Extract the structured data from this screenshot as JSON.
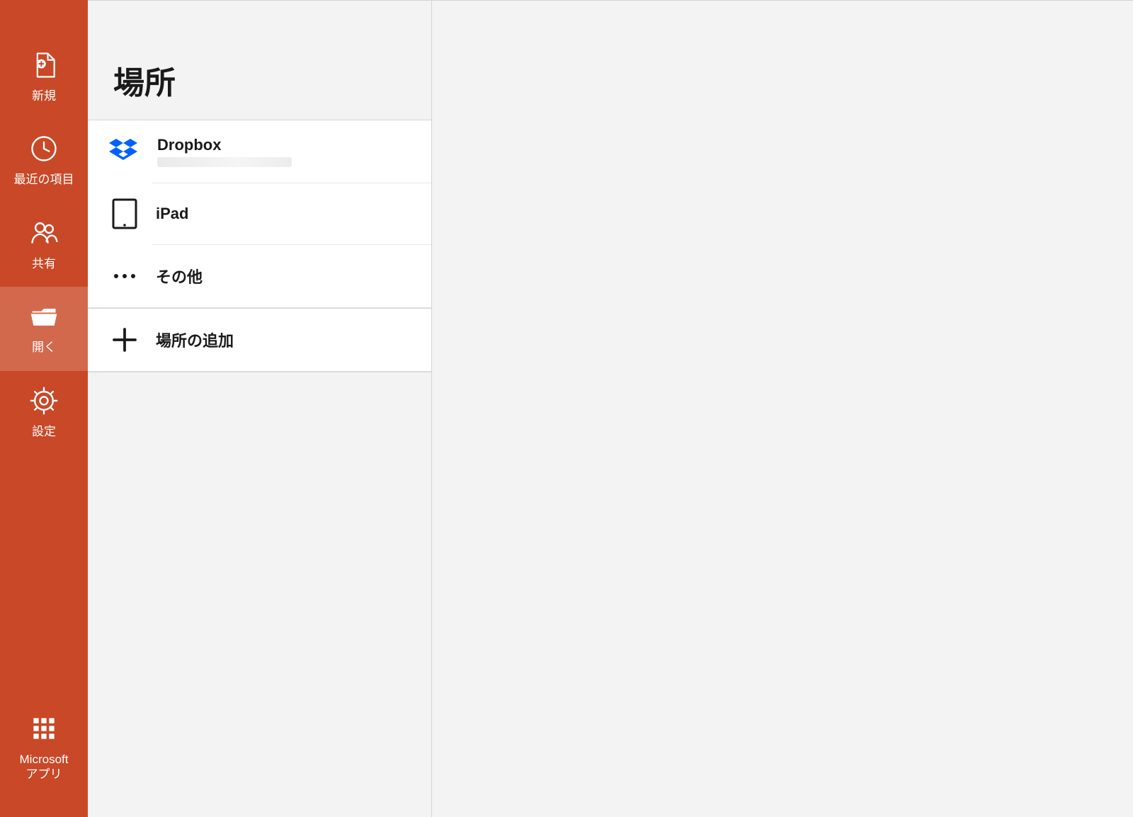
{
  "sidebar": {
    "items": [
      {
        "id": "new",
        "label": "新規"
      },
      {
        "id": "recent",
        "label": "最近の項目"
      },
      {
        "id": "share",
        "label": "共有"
      },
      {
        "id": "open",
        "label": "開く"
      },
      {
        "id": "settings",
        "label": "設定"
      }
    ],
    "bottom": {
      "id": "msapps",
      "label": "Microsoft\nアプリ"
    },
    "active_id": "open"
  },
  "places": {
    "title": "場所",
    "locations": [
      {
        "id": "dropbox",
        "label": "Dropbox",
        "subtitle_redacted": true
      },
      {
        "id": "ipad",
        "label": "iPad"
      },
      {
        "id": "other",
        "label": "その他"
      }
    ],
    "add_label": "場所の追加"
  },
  "colors": {
    "brand": "#c84827",
    "dropbox_blue": "#0061fe"
  }
}
